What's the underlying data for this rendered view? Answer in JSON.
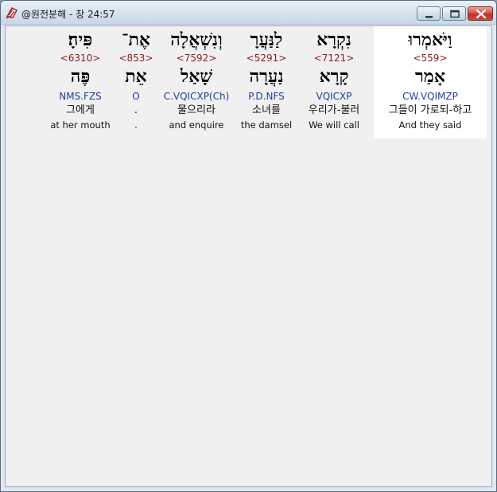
{
  "window": {
    "title": "@원전분해 - 창 24:57",
    "colors": {
      "strong_number": "#8b1a1a",
      "morphology": "#1f3ea0",
      "highlight_background": "#ffffff",
      "client_background": "#f0f0f0"
    }
  },
  "words": [
    {
      "hebrew": "וַיֹּאמְרוּ",
      "strong": "<559>",
      "lemma": "אָמַר",
      "morph": "CW.VQIMZP",
      "korean": "그들이 가로되-하고",
      "english": "And they said",
      "selected": true
    },
    {
      "hebrew": "נִקְרָא",
      "strong": "<7121>",
      "lemma": "קָרָא",
      "morph": "VQICXP",
      "korean": "우리가-불러",
      "english": "We will call",
      "selected": false
    },
    {
      "hebrew": "לַנַּעֲרָ",
      "strong": "<5291>",
      "lemma": "נַעֲרָה",
      "morph": "P.D.NFS",
      "korean": "소녀를",
      "english": "the damsel",
      "selected": false
    },
    {
      "hebrew": "וְנִשְׁאֲלָה",
      "strong": "<7592>",
      "lemma": "שָׁאַל",
      "morph": "C.VQICXP(Ch)",
      "korean": "물으리라",
      "english": "and enquire",
      "selected": false
    },
    {
      "hebrew": "אֶת־",
      "strong": "<853>",
      "lemma": "אֵת",
      "morph": "O",
      "korean": ".",
      "english": ".",
      "selected": false
    },
    {
      "hebrew": "פִּיהָ׃",
      "strong": "<6310>",
      "lemma": "פֶּה",
      "morph": "NMS.FZS",
      "korean": "그에게",
      "english": "at her mouth",
      "selected": false
    }
  ]
}
